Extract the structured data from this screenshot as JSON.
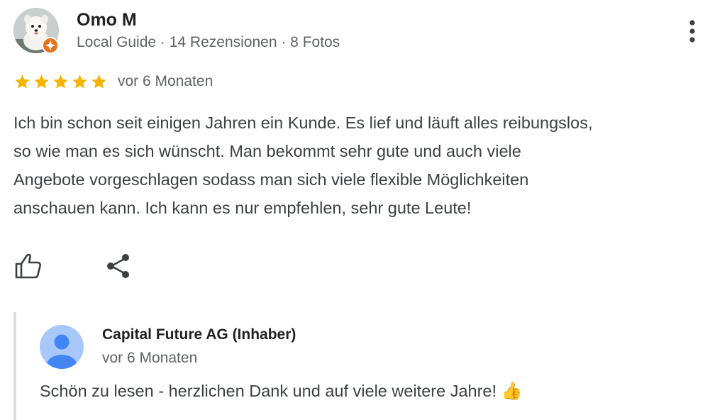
{
  "review": {
    "reviewer": {
      "name": "Omo M",
      "meta": "Local Guide · 14 Rezensionen · 8 Fotos",
      "avatar_icon": "dog-photo-avatar",
      "badge_icon": "local-guide-badge-icon"
    },
    "rating": {
      "stars": 5,
      "max": 5,
      "star_color": "#f4b400",
      "date": "vor 6 Monaten"
    },
    "text_lines": [
      "Ich bin schon seit einigen Jahren ein Kunde. Es lief und läuft alles reibungslos,",
      "so wie man es sich wünscht. Man bekommt sehr gute und auch viele",
      "Angebote vorgeschlagen sodass man sich viele flexible Möglichkeiten",
      "anschauen kann. Ich kann es nur empfehlen, sehr gute Leute!"
    ],
    "actions": {
      "like_icon": "thumbs-up-icon",
      "share_icon": "share-icon",
      "more_icon": "more-vert-icon"
    }
  },
  "owner_reply": {
    "name": "Capital Future AG (Inhaber)",
    "date": "vor 6 Monaten",
    "text": "Schön zu lesen - herzlichen Dank und auf viele weitere Jahre!",
    "emoji": "👍",
    "avatar_icon": "default-person-avatar",
    "avatar_bg": "#a8c7fa",
    "avatar_fg": "#4285f4"
  },
  "colors": {
    "text_primary": "#202124",
    "text_secondary": "#5f6368",
    "badge": "#e8711a",
    "divider": "#dadce0"
  }
}
